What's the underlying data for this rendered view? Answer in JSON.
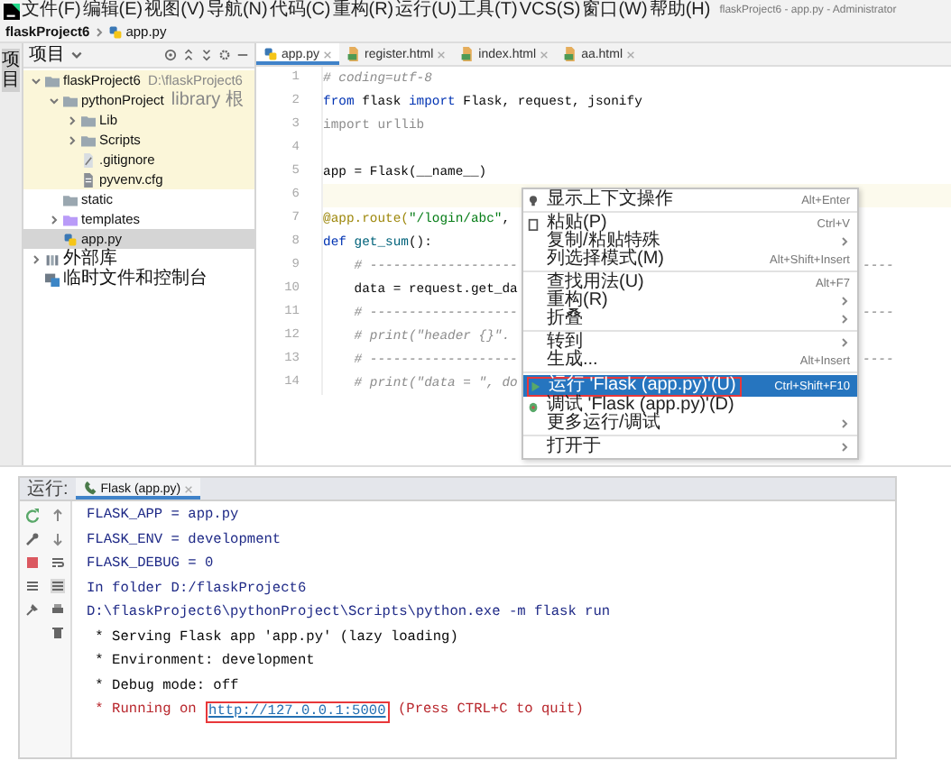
{
  "window": {
    "title": "flaskProject6 - app.py - Administrator"
  },
  "menu_bar": [
    "文件(F)",
    "编辑(E)",
    "视图(V)",
    "导航(N)",
    "代码(C)",
    "重构(R)",
    "运行(U)",
    "工具(T)",
    "VCS(S)",
    "窗口(W)",
    "帮助(H)"
  ],
  "breadcrumb": [
    "flaskProject6",
    "app.py"
  ],
  "project_panel": {
    "side_label": "项目",
    "title": "项目",
    "tree": [
      {
        "label": "flaskProject6",
        "note": "D:\\flaskProject6",
        "kind": "folder",
        "expanded": true,
        "highlighted": true,
        "selected": false,
        "children": [
          {
            "label": "pythonProject",
            "note": "library 根",
            "kind": "folder",
            "expanded": true,
            "highlighted": true,
            "selected": false,
            "children": [
              {
                "label": "Lib",
                "kind": "folder",
                "expanded": false,
                "highlighted": true,
                "selected": false
              },
              {
                "label": "Scripts",
                "kind": "folder",
                "expanded": false,
                "highlighted": true,
                "selected": false
              },
              {
                "label": ".gitignore",
                "kind": "ignore-file",
                "highlighted": true,
                "selected": false
              },
              {
                "label": "pyvenv.cfg",
                "kind": "text-file",
                "highlighted": true,
                "selected": false
              }
            ]
          },
          {
            "label": "static",
            "kind": "folder",
            "highlighted": false,
            "selected": false
          },
          {
            "label": "templates",
            "kind": "template-folder",
            "expanded": false,
            "highlighted": false,
            "selected": false
          },
          {
            "label": "app.py",
            "kind": "python-file",
            "highlighted": false,
            "selected": true
          }
        ]
      },
      {
        "label": "外部库",
        "kind": "library",
        "expanded": false,
        "highlighted": false,
        "selected": false
      },
      {
        "label": "临时文件和控制台",
        "kind": "scratch",
        "highlighted": false,
        "selected": false
      }
    ]
  },
  "editor": {
    "tabs": [
      {
        "label": "app.py",
        "kind": "python-file",
        "selected": true
      },
      {
        "label": "register.html",
        "kind": "html-file",
        "selected": false
      },
      {
        "label": "index.html",
        "kind": "html-file",
        "selected": false
      },
      {
        "label": "aa.html",
        "kind": "html-file",
        "selected": false
      }
    ],
    "lines": [
      {
        "number": "1",
        "current": false,
        "tokens": [
          {
            "text": "# coding=utf-8",
            "kind": "comment"
          }
        ]
      },
      {
        "number": "2",
        "current": false,
        "tokens": [
          {
            "text": "from",
            "kind": "keyword"
          },
          {
            "text": " flask ",
            "kind": "plain"
          },
          {
            "text": "import",
            "kind": "keyword"
          },
          {
            "text": " Flask, request, jsonify",
            "kind": "plain"
          }
        ]
      },
      {
        "number": "3",
        "current": false,
        "tokens": [
          {
            "text": "import urllib",
            "kind": "unused"
          }
        ]
      },
      {
        "number": "4",
        "current": false
      },
      {
        "number": "5",
        "current": false,
        "tokens": [
          {
            "text": "app = Flask(__name__)",
            "kind": "plain"
          }
        ]
      },
      {
        "number": "6",
        "current": true
      },
      {
        "number": "7",
        "current": false,
        "tokens": [
          {
            "text": "@app.route(",
            "kind": "decorator"
          },
          {
            "text": "\"/login/abc\"",
            "kind": "string"
          },
          {
            "text": ", ",
            "kind": "plain"
          }
        ]
      },
      {
        "number": "8",
        "current": false,
        "tokens": [
          {
            "text": "def ",
            "kind": "keyword"
          },
          {
            "text": "get_sum",
            "kind": "function"
          },
          {
            "text": "():",
            "kind": "plain"
          }
        ]
      },
      {
        "number": "9",
        "current": false,
        "tokens": [
          {
            "text": "    # -------------------",
            "kind": "comment"
          }
        ],
        "tail": "----"
      },
      {
        "number": "10",
        "current": false,
        "tokens": [
          {
            "text": "    data = request.get_da",
            "kind": "plain"
          }
        ]
      },
      {
        "number": "11",
        "current": false,
        "tokens": [
          {
            "text": "    # -------------------",
            "kind": "comment"
          }
        ],
        "tail": "----"
      },
      {
        "number": "12",
        "current": false,
        "tokens": [
          {
            "text": "    # print(\"header {}\".",
            "kind": "comment"
          }
        ]
      },
      {
        "number": "13",
        "current": false,
        "tokens": [
          {
            "text": "    # -------------------",
            "kind": "comment"
          }
        ],
        "tail": "----"
      },
      {
        "number": "14",
        "current": false,
        "tokens": [
          {
            "text": "    # print(\"data = \", do",
            "kind": "comment"
          }
        ]
      }
    ]
  },
  "context_menu": {
    "groups": [
      [
        {
          "label": "显示上下文操作",
          "kind": "bulb",
          "shortcut": "Alt+Enter",
          "submenu": false,
          "selected": false,
          "annotated": false
        }
      ],
      [
        {
          "label": "粘贴(P)",
          "kind": "clipboard",
          "shortcut": "Ctrl+V",
          "submenu": false,
          "selected": false,
          "annotated": false
        },
        {
          "label": "复制/粘贴特殊",
          "submenu": true,
          "selected": false,
          "annotated": false
        },
        {
          "label": "列选择模式(M)",
          "shortcut": "Alt+Shift+Insert",
          "submenu": false,
          "selected": false,
          "annotated": false
        }
      ],
      [
        {
          "label": "查找用法(U)",
          "shortcut": "Alt+F7",
          "submenu": false,
          "selected": false,
          "annotated": false
        },
        {
          "label": "重构(R)",
          "submenu": true,
          "selected": false,
          "annotated": false
        },
        {
          "label": "折叠",
          "submenu": true,
          "selected": false,
          "annotated": false
        }
      ],
      [
        {
          "label": "转到",
          "submenu": true,
          "selected": false,
          "annotated": false
        },
        {
          "label": "生成...",
          "shortcut": "Alt+Insert",
          "submenu": false,
          "selected": false,
          "annotated": false
        }
      ],
      [
        {
          "label": "运行 'Flask (app.py)'(U)",
          "kind": "run",
          "shortcut": "Ctrl+Shift+F10",
          "submenu": false,
          "selected": true,
          "annotated": true
        },
        {
          "label": "调试 'Flask (app.py)'(D)",
          "kind": "debug",
          "submenu": false,
          "selected": false,
          "annotated": false
        },
        {
          "label": "更多运行/调试",
          "submenu": true,
          "selected": false,
          "annotated": false
        }
      ],
      [
        {
          "label": "打开于",
          "submenu": true,
          "selected": false,
          "annotated": false
        }
      ]
    ]
  },
  "run_panel": {
    "label": "运行:",
    "tabs": [
      {
        "label": "Flask (app.py)",
        "selected": true
      }
    ],
    "console": [
      {
        "kind": "system",
        "text": "FLASK_APP = app.py"
      },
      {
        "kind": "system",
        "text": "FLASK_ENV = development"
      },
      {
        "kind": "system",
        "text": "FLASK_DEBUG = 0"
      },
      {
        "kind": "system",
        "text": "In folder D:/flaskProject6"
      },
      {
        "kind": "system",
        "text": "D:\\flaskProject6\\pythonProject\\Scripts\\python.exe -m flask run"
      },
      {
        "kind": "stdout",
        "text": " * Serving Flask app 'app.py' (lazy loading)"
      },
      {
        "kind": "stdout",
        "text": " * Environment: development"
      },
      {
        "kind": "stdout",
        "text": " * Debug mode: off"
      },
      {
        "kind": "stderr",
        "text": " * Running on ",
        "link": "http://127.0.0.1:5000",
        "link_annotated": true,
        "after": " (Press CTRL+C to quit)"
      }
    ]
  }
}
